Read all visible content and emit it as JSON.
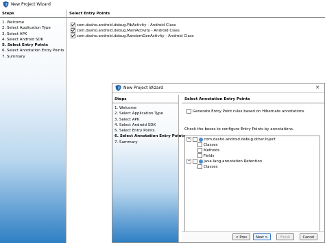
{
  "back_window": {
    "title": "New Project Wizard",
    "steps_header": "Steps",
    "steps": [
      "1. Welcome",
      "2. Select Application Type",
      "3. Select APK",
      "4. Select Android SDK",
      "5. Select Entry Points",
      "6. Select Annotation Entry Points",
      "7. Summary"
    ],
    "current_step_index": 4,
    "panel_header": "Select Entry Points",
    "entry_points": [
      {
        "label": "com.dasho.android.debug.FibActivity - Android Class",
        "checked": true
      },
      {
        "label": "com.dasho.android.debug.MainActivity - Android Class",
        "checked": true
      },
      {
        "label": "com.dasho.android.debug.RandomGenActivity - Android Class",
        "checked": true
      }
    ]
  },
  "front_window": {
    "title": "New Project Wizard",
    "close_glyph": "✕",
    "steps_header": "Steps",
    "steps": [
      "1. Welcome",
      "2. Select Application Type",
      "3. Select APK",
      "4. Select Android SDK",
      "5. Select Entry Points",
      "6. Select Annotation Entry Points",
      "7. Summary"
    ],
    "current_step_index": 5,
    "panel_header": "Select Annotation Entry Points",
    "hibernate_option": {
      "label": "Generate Entry Point rules based on Hibernate annotations",
      "checked": false
    },
    "instructions": "Check the boxes to configure Entry Points by annotations.",
    "tree": [
      {
        "label": "com.dasho.android.debug.other.Inject",
        "children": [
          "Classes",
          "Methods",
          "Fields"
        ]
      },
      {
        "label": "java.lang.annotation.Retention",
        "children": [
          "Classes"
        ]
      }
    ],
    "buttons": {
      "back": "< Prev",
      "next": "Next >",
      "finish": "Finish",
      "cancel": "Cancel"
    }
  },
  "colors": {
    "accent": "#2e7fc4",
    "icon": "#1f5fa8"
  }
}
